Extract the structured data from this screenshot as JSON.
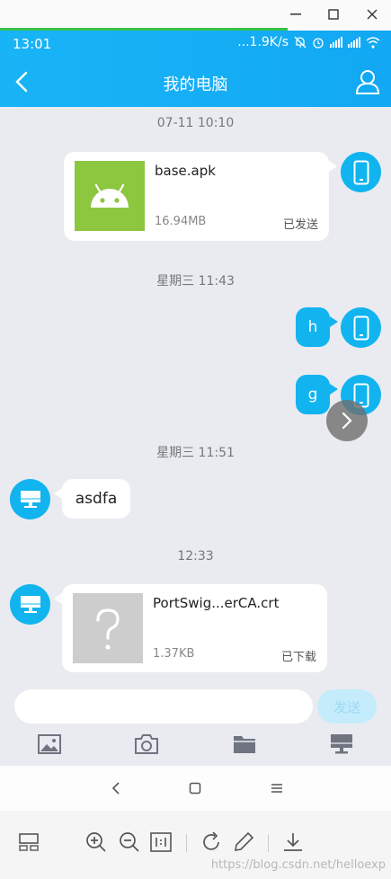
{
  "window": {
    "minimize": "—",
    "maximize": "☐",
    "close": "✕"
  },
  "status": {
    "time": "13:01",
    "speed": "...1.9K/s"
  },
  "header": {
    "title": "我的电脑"
  },
  "messages": {
    "t1": "07-11 10:10",
    "f1_name": "base.apk",
    "f1_size": "16.94MB",
    "f1_status": "已发送",
    "t2": "星期三 11:43",
    "m_h": "h",
    "m_g": "g",
    "t3": "星期三 11:51",
    "m_asdfa": "asdfa",
    "t4": "12:33",
    "f2_name": "PortSwig...erCA.crt",
    "f2_size": "1.37KB",
    "f2_status": "已下载"
  },
  "input": {
    "placeholder": "",
    "send_label": "发送"
  },
  "viewer": {
    "watermark": "https://blog.csdn.net/helloexp"
  },
  "colors": {
    "accent": "#11b4ef",
    "chat_bg": "#e9ebf1",
    "android_green": "#8dc63f"
  }
}
